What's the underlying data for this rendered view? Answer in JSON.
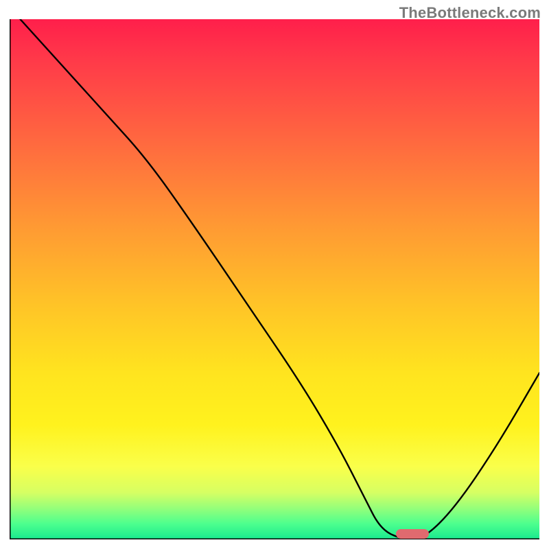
{
  "watermark": "TheBottleneck.com",
  "chart_data": {
    "type": "line",
    "title": "",
    "xlabel": "",
    "ylabel": "",
    "xlim": [
      0,
      100
    ],
    "ylim": [
      0,
      100
    ],
    "grid": false,
    "legend": false,
    "series": [
      {
        "name": "curve",
        "x": [
          2,
          10,
          18,
          26,
          35,
          45,
          55,
          62,
          67,
          70,
          74,
          78,
          84,
          92,
          100
        ],
        "y": [
          100,
          91,
          82,
          73,
          60,
          45,
          30,
          18,
          8,
          2,
          0,
          0,
          6,
          18,
          32
        ]
      }
    ],
    "marker": {
      "x": 76,
      "y": 1
    },
    "gradient_stops": [
      {
        "pos": 0.0,
        "color": "#ff1f4b"
      },
      {
        "pos": 0.24,
        "color": "#ff6a3f"
      },
      {
        "pos": 0.55,
        "color": "#ffc427"
      },
      {
        "pos": 0.78,
        "color": "#fff21e"
      },
      {
        "pos": 0.94,
        "color": "#95ff7a"
      },
      {
        "pos": 1.0,
        "color": "#18e98f"
      }
    ]
  }
}
